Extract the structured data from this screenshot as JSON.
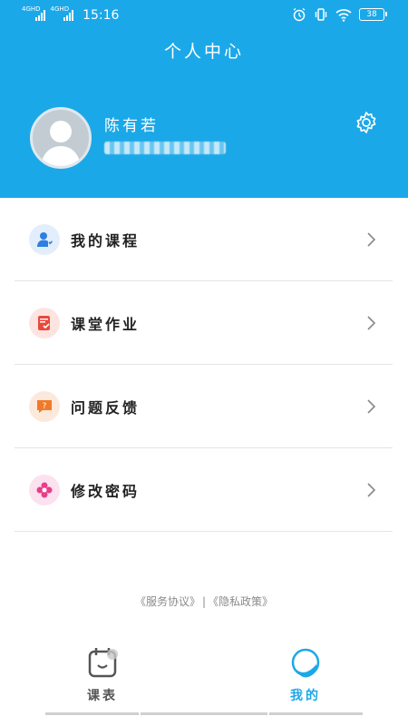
{
  "status_bar": {
    "signal1": "4GHD",
    "signal2": "4GHD",
    "time": "15:16",
    "battery": "38"
  },
  "header": {
    "title": "个人中心"
  },
  "profile": {
    "name": "陈有若"
  },
  "menu": {
    "items": [
      {
        "label": "我的课程",
        "icon": "user-course-icon",
        "color": "#2f7fe0"
      },
      {
        "label": "课堂作业",
        "icon": "homework-icon",
        "color": "#e9493a"
      },
      {
        "label": "问题反馈",
        "icon": "feedback-icon",
        "color": "#f07a2a"
      },
      {
        "label": "修改密码",
        "icon": "flower-lock-icon",
        "color": "#ea3c8a"
      }
    ]
  },
  "footer": {
    "agreement": "《服务协议》",
    "divider": "|",
    "privacy": "《隐私政策》"
  },
  "tabs": {
    "schedule": "课表",
    "mine": "我的"
  },
  "colors": {
    "brand": "#1ba8e8",
    "tab_inactive": "#555555",
    "tab_active": "#1ba8e8"
  }
}
